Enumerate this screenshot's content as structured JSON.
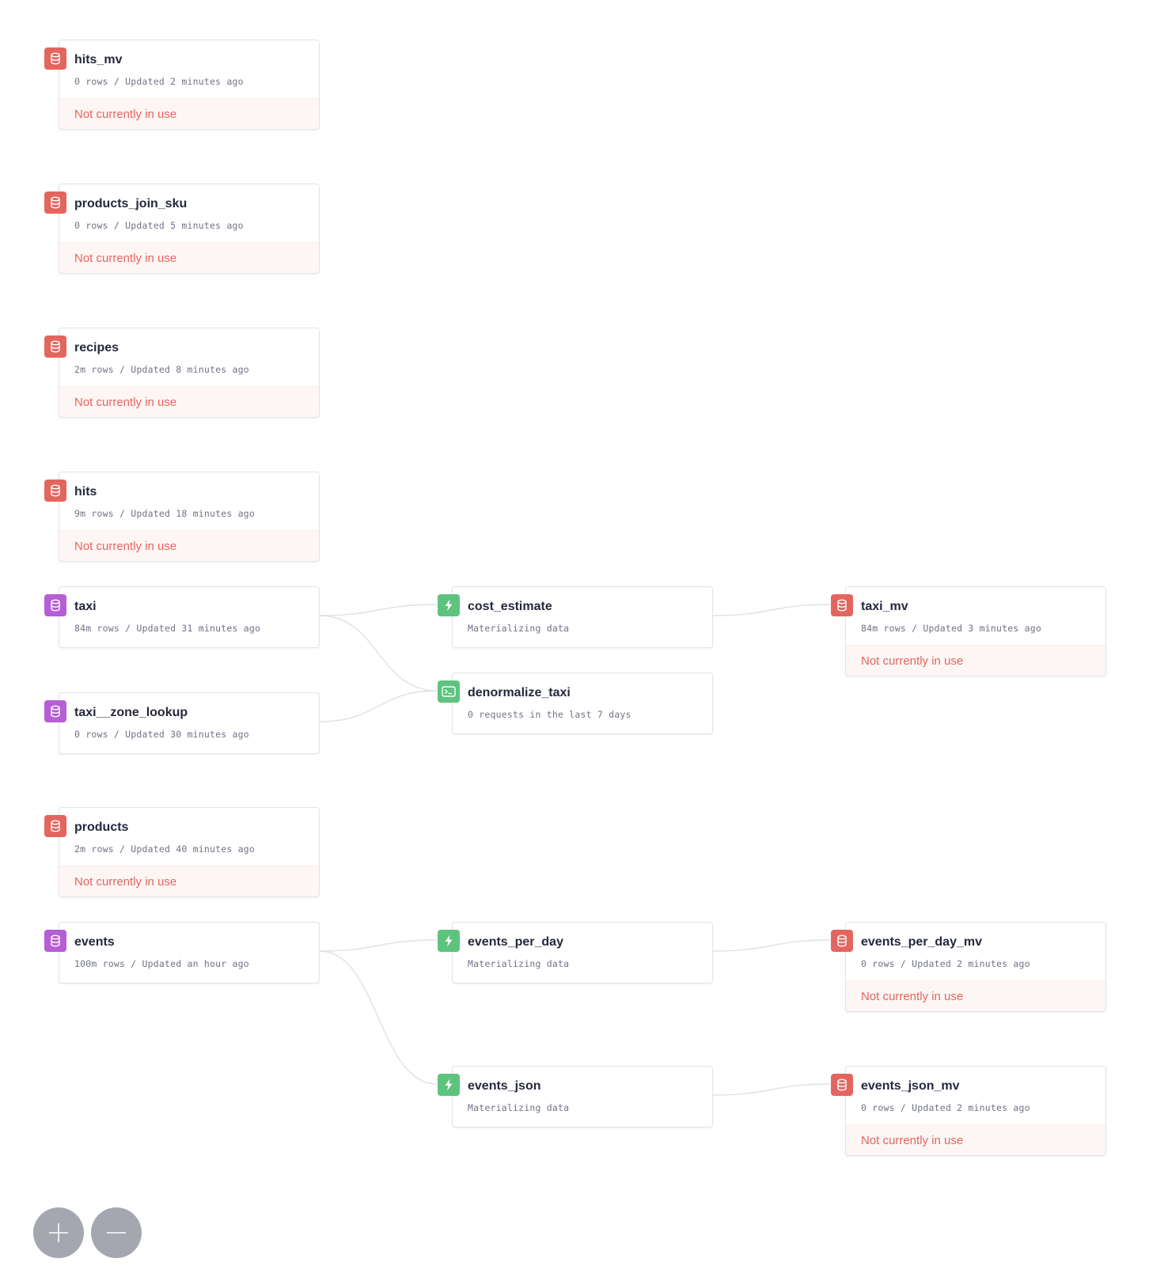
{
  "colors": {
    "datasource_red": "#e4655f",
    "datasource_purple": "#b55ed6",
    "pipe_green": "#5dc37e",
    "edge": "#dfe1e6",
    "zoom_button": "#a5a7b0"
  },
  "nodes": {
    "hits_mv": {
      "title": "hits_mv",
      "meta": "0 rows / Updated 2 minutes ago",
      "status": "Not currently in use",
      "icon": "database-icon"
    },
    "products_join_sku": {
      "title": "products_join_sku",
      "meta": "0 rows / Updated 5 minutes ago",
      "status": "Not currently in use",
      "icon": "database-icon"
    },
    "recipes": {
      "title": "recipes",
      "meta": "2m rows / Updated 8 minutes ago",
      "status": "Not currently in use",
      "icon": "database-icon"
    },
    "hits": {
      "title": "hits",
      "meta": "9m rows / Updated 18 minutes ago",
      "status": "Not currently in use",
      "icon": "database-icon"
    },
    "taxi": {
      "title": "taxi",
      "meta": "84m rows / Updated 31 minutes ago",
      "icon": "database-icon"
    },
    "taxi_zone_lookup": {
      "title": "taxi__zone_lookup",
      "meta": "0 rows / Updated 30 minutes ago",
      "icon": "database-icon"
    },
    "products": {
      "title": "products",
      "meta": "2m rows / Updated 40 minutes ago",
      "status": "Not currently in use",
      "icon": "database-icon"
    },
    "events": {
      "title": "events",
      "meta": "100m rows / Updated an hour ago",
      "icon": "database-icon"
    },
    "cost_estimate": {
      "title": "cost_estimate",
      "meta": "Materializing data",
      "icon": "lightning-icon"
    },
    "denormalize_taxi": {
      "title": "denormalize_taxi",
      "meta": "0 requests in the last 7 days",
      "icon": "terminal-icon"
    },
    "events_per_day": {
      "title": "events_per_day",
      "meta": "Materializing data",
      "icon": "lightning-icon"
    },
    "events_json": {
      "title": "events_json",
      "meta": "Materializing data",
      "icon": "lightning-icon"
    },
    "taxi_mv": {
      "title": "taxi_mv",
      "meta": "84m rows / Updated 3 minutes ago",
      "status": "Not currently in use",
      "icon": "database-icon"
    },
    "events_per_day_mv": {
      "title": "events_per_day_mv",
      "meta": "0 rows / Updated 2 minutes ago",
      "status": "Not currently in use",
      "icon": "database-icon"
    },
    "events_json_mv": {
      "title": "events_json_mv",
      "meta": "0 rows / Updated 2 minutes ago",
      "status": "Not currently in use",
      "icon": "database-icon"
    }
  },
  "edges": [
    [
      "taxi",
      "cost_estimate"
    ],
    [
      "taxi",
      "denormalize_taxi"
    ],
    [
      "taxi_zone_lookup",
      "denormalize_taxi"
    ],
    [
      "cost_estimate",
      "taxi_mv"
    ],
    [
      "events",
      "events_per_day"
    ],
    [
      "events",
      "events_json"
    ],
    [
      "events_per_day",
      "events_per_day_mv"
    ],
    [
      "events_json",
      "events_json_mv"
    ]
  ],
  "zoom_controls": {
    "zoom_in_icon": "plus-icon",
    "zoom_out_icon": "minus-icon"
  }
}
